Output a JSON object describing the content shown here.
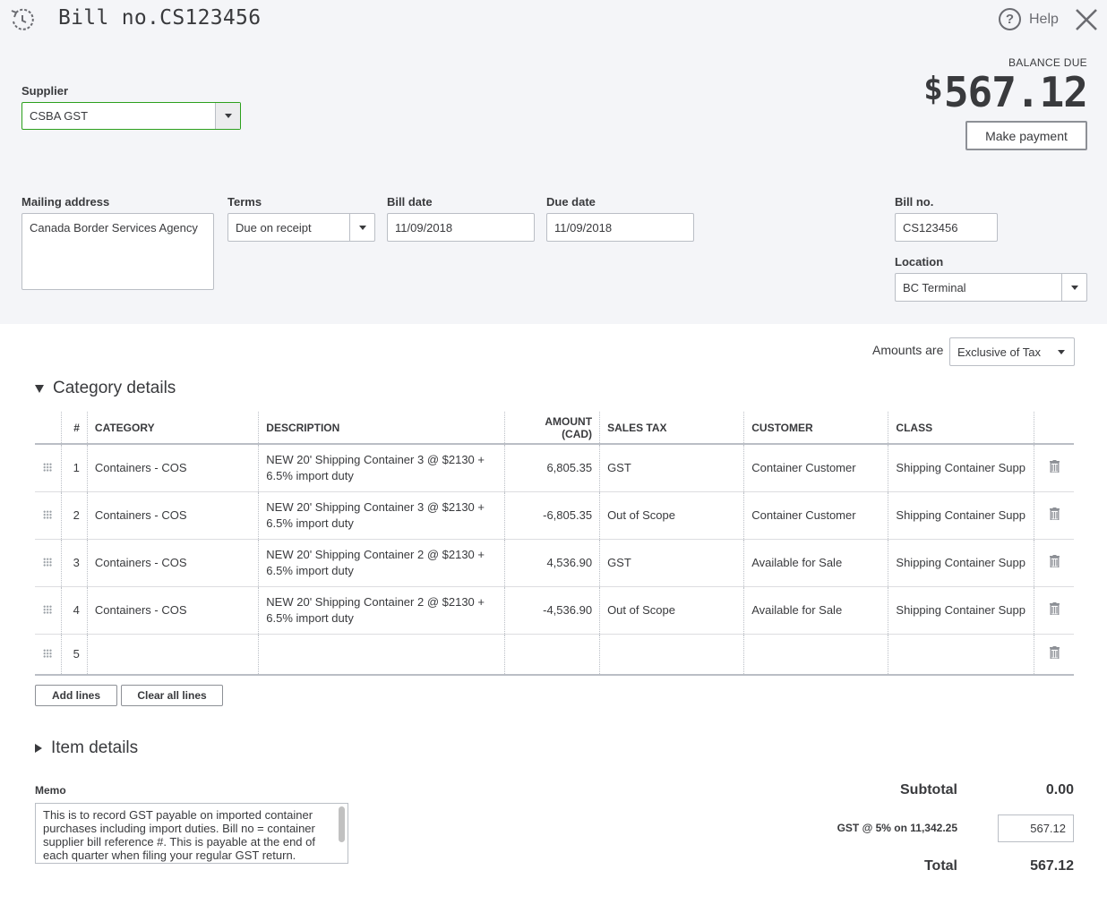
{
  "header": {
    "title": "Bill no.CS123456",
    "help_label": "Help",
    "balance_label": "BALANCE DUE",
    "balance_currency": "$",
    "balance_amount": "567.12",
    "make_payment_label": "Make payment"
  },
  "form": {
    "supplier_label": "Supplier",
    "supplier_value": "CSBA GST",
    "mailing_label": "Mailing address",
    "mailing_value": "Canada Border Services Agency",
    "terms_label": "Terms",
    "terms_value": "Due on receipt",
    "bill_date_label": "Bill date",
    "bill_date_value": "11/09/2018",
    "due_date_label": "Due date",
    "due_date_value": "11/09/2018",
    "bill_no_label": "Bill no.",
    "bill_no_value": "CS123456",
    "location_label": "Location",
    "location_value": "BC Terminal"
  },
  "amounts": {
    "label": "Amounts are",
    "value": "Exclusive of Tax"
  },
  "category": {
    "title": "Category details",
    "headers": {
      "num": "#",
      "category": "CATEGORY",
      "description": "DESCRIPTION",
      "amount": "AMOUNT (CAD)",
      "sales_tax": "SALES TAX",
      "customer": "CUSTOMER",
      "class": "CLASS"
    },
    "rows": [
      {
        "num": "1",
        "category": "Containers - COS",
        "description": "NEW 20' Shipping Container 3 @ $2130 + 6.5% import duty",
        "amount": "6,805.35",
        "sales_tax": "GST",
        "customer": "Container Customer",
        "class": "Shipping Container Supp"
      },
      {
        "num": "2",
        "category": "Containers - COS",
        "description": "NEW 20' Shipping Container 3 @ $2130  + 6.5% import duty",
        "amount": "-6,805.35",
        "sales_tax": "Out of Scope",
        "customer": "Container Customer",
        "class": "Shipping Container Supp"
      },
      {
        "num": "3",
        "category": "Containers - COS",
        "description": "NEW 20' Shipping Container 2 @ $2130  + 6.5% import duty",
        "amount": "4,536.90",
        "sales_tax": "GST",
        "customer": "Available for Sale",
        "class": "Shipping Container Supp"
      },
      {
        "num": "4",
        "category": "Containers - COS",
        "description": "NEW 20' Shipping Container 2 @ $2130  + 6.5% import duty",
        "amount": "-4,536.90",
        "sales_tax": "Out of Scope",
        "customer": "Available for Sale",
        "class": "Shipping Container Supp"
      },
      {
        "num": "5",
        "category": "",
        "description": "",
        "amount": "",
        "sales_tax": "",
        "customer": "",
        "class": ""
      }
    ],
    "add_lines_label": "Add lines",
    "clear_lines_label": "Clear all lines"
  },
  "item": {
    "title": "Item details"
  },
  "memo": {
    "label": "Memo",
    "value": "This is to record GST payable on imported container purchases including import duties. Bill no = container supplier bill reference #. This is payable at the end of each quarter when filing your regular GST return."
  },
  "totals": {
    "subtotal_label": "Subtotal",
    "subtotal_value": "0.00",
    "gst_label": "GST @ 5% on 11,342.25",
    "gst_value": "567.12",
    "total_label": "Total",
    "total_value": "567.12"
  },
  "icons": {
    "history": "history-icon",
    "help": "help-icon",
    "close": "close-icon",
    "drag": "drag-handle-icon",
    "delete": "trash-icon"
  },
  "colors": {
    "accent_green": "#2ca01c",
    "header_bg": "#f4f5f8",
    "text": "#393a3d"
  }
}
